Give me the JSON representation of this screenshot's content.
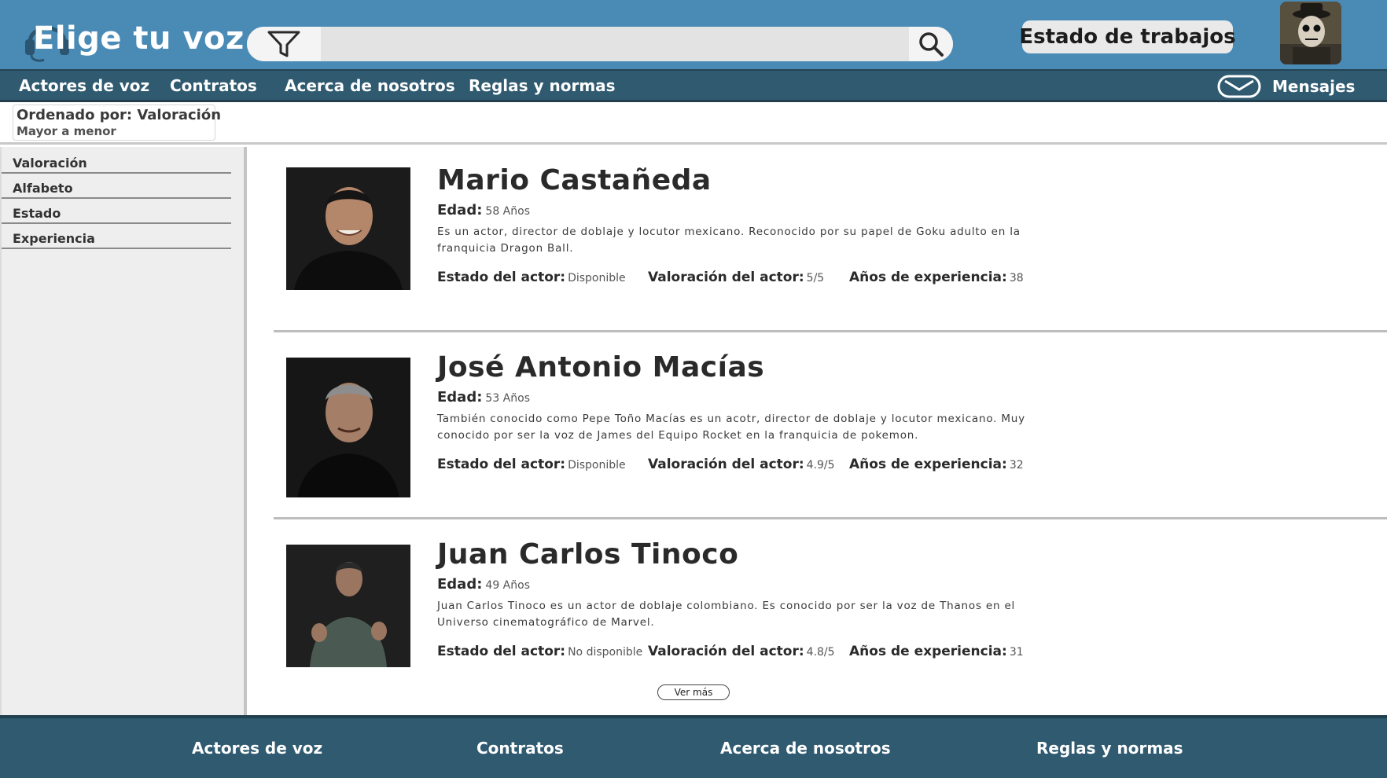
{
  "header": {
    "logo_text": "Elige tu voz",
    "search": {
      "placeholder": ""
    },
    "jobs_button_label": "Estado de trabajos"
  },
  "nav": {
    "items": [
      {
        "label": "Actores de voz"
      },
      {
        "label": "Contratos"
      },
      {
        "label": "Acerca de nosotros"
      },
      {
        "label": "Reglas y normas"
      }
    ],
    "messages_label": "Mensajes"
  },
  "sort": {
    "title": "Ordenado por: Valoración",
    "subtitle": "Mayor a menor"
  },
  "sidebar": {
    "items": [
      {
        "label": "Valoración"
      },
      {
        "label": "Alfabeto"
      },
      {
        "label": "Estado"
      },
      {
        "label": "Experiencia"
      }
    ]
  },
  "labels": {
    "age": "Edad:",
    "status": "Estado del actor:",
    "rating": "Valoración del actor:",
    "experience": "Años de experiencia:"
  },
  "actors": [
    {
      "name": "Mario Castañeda",
      "age": "58 Años",
      "description": "Es un actor, director de doblaje y locutor mexicano. Reconocido por su papel de Goku adulto en la franquicia Dragon Ball.",
      "status": "Disponible",
      "rating": "5/5",
      "experience": "38"
    },
    {
      "name": "José Antonio Macías",
      "age": "53 Años",
      "description": "También conocido como Pepe Toño Macías es un acotr, director de doblaje y locutor mexicano. Muy conocido por ser la voz de James del Equipo Rocket en la franquicia de pokemon.",
      "status": "Disponible",
      "rating": "4.9/5",
      "experience": "32"
    },
    {
      "name": "Juan Carlos Tinoco",
      "age": "49 Años",
      "description": "Juan Carlos Tinoco es un actor de doblaje colombiano. Es conocido por ser la voz de Thanos en el Universo cinematográfico de Marvel.",
      "status": "No disponible",
      "rating": "4.8/5",
      "experience": "31"
    }
  ],
  "more_button_label": "Ver más",
  "footer": {
    "items": [
      {
        "label": "Actores de voz"
      },
      {
        "label": "Contratos"
      },
      {
        "label": "Acerca de nosotros"
      },
      {
        "label": "Reglas y normas"
      }
    ]
  },
  "colors": {
    "header_bg": "#4a8bb6",
    "nav_bg": "#2f5a70",
    "sidebar_bg": "#eeeeee"
  }
}
